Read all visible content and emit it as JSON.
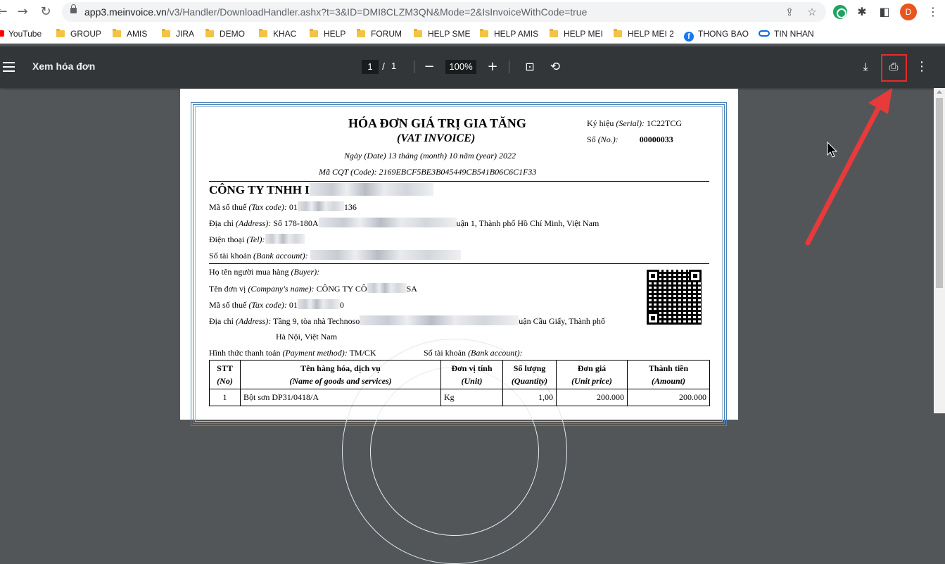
{
  "browser": {
    "url_host": "app3.meinvoice.vn",
    "url_path": "/v3/Handler/DownloadHandler.ashx?t=3&ID=DMI8CLZM3QN&Mode=2&IsInvoiceWithCode=true",
    "avatar_letter": "D",
    "bookmarks": [
      "YouTube",
      "GROUP",
      "AMIS",
      "JIRA",
      "DEMO",
      "KHAC",
      "HELP",
      "FORUM",
      "HELP SME",
      "HELP AMIS",
      "HELP MEI",
      "HELP MEI 2",
      "THONG BAO",
      "TIN NHAN"
    ]
  },
  "pdf_toolbar": {
    "title": "Xem hóa đơn",
    "page_current": "1",
    "page_sep": "/",
    "page_total": "1",
    "zoom": "100%"
  },
  "invoice": {
    "title": "HÓA ĐƠN GIÁ TRỊ GIA TĂNG",
    "subtitle": "(VAT INVOICE)",
    "serial_label": "Ký hiệu",
    "serial_label_en": "(Serial):",
    "serial_value": "1C22TCG",
    "no_label": "Số",
    "no_label_en": "(No.):",
    "no_value": "00000033",
    "date_line": "Ngày (Date) 13 tháng (month) 10 năm (year) 2022",
    "cqt_line": "Mã CQT (Code): 2169EBCF5BE3B045449CB541B06C6C1F33",
    "seller_name": "CÔNG TY TNHH I",
    "seller_tax_label": "Mã số thuế",
    "seller_tax_label_en": "(Tax code):",
    "seller_tax_start": "01",
    "seller_tax_end": "136",
    "seller_address_label": "Địa chỉ",
    "seller_address_label_en": "(Address):",
    "seller_address_start": "Số 178-180A",
    "seller_address_end": "uận 1, Thành phố Hồ Chí Minh, Việt Nam",
    "seller_tel_label": "Điện thoại",
    "seller_tel_label_en": "(Tel):",
    "seller_bank_label": "Số tài khoản",
    "seller_bank_label_en": "(Bank account):",
    "buyer_label": "Họ tên người mua hàng",
    "buyer_label_en": "(Buyer):",
    "company_label": "Tên đơn vị",
    "company_label_en": "(Company's name):",
    "company_start": "CÔNG TY CÔ",
    "company_end": "SA",
    "buyer_tax_label": "Mã số thuế",
    "buyer_tax_label_en": "(Tax code):",
    "buyer_tax_start": "01",
    "buyer_tax_end": "0",
    "buyer_address_label": "Địa chỉ",
    "buyer_address_label_en": "(Address):",
    "buyer_address_start": "Tầng 9, tòa nhà Technoso",
    "buyer_address_end": "uận Cầu Giấy, Thành phố",
    "buyer_address_line2": "Hà Nội, Việt Nam",
    "payment_label": "Hình thức thanh toán",
    "payment_label_en": "(Payment method):",
    "payment_value": "TM/CK",
    "buyer_bank_label": "Số tài khoản",
    "buyer_bank_label_en": "(Bank account):",
    "table": {
      "headers": [
        {
          "vi": "STT",
          "en": "(No)"
        },
        {
          "vi": "Tên hàng hóa, dịch vụ",
          "en": "(Name of goods and services)"
        },
        {
          "vi": "Đơn vị tính",
          "en": "(Unit)"
        },
        {
          "vi": "Số lượng",
          "en": "(Quantity)"
        },
        {
          "vi": "Đơn giá",
          "en": "(Unit price)"
        },
        {
          "vi": "Thành tiền",
          "en": "(Amount)"
        }
      ],
      "rows": [
        {
          "no": "1",
          "name": "Bột sơn DP31/0418/A",
          "unit": "Kg",
          "qty": "1,00",
          "price": "200.000",
          "amount": "200.000"
        }
      ]
    }
  },
  "colors": {
    "annotation_red": "#e62a2a",
    "toolbar_bg": "#323639",
    "viewer_bg": "#525659"
  }
}
